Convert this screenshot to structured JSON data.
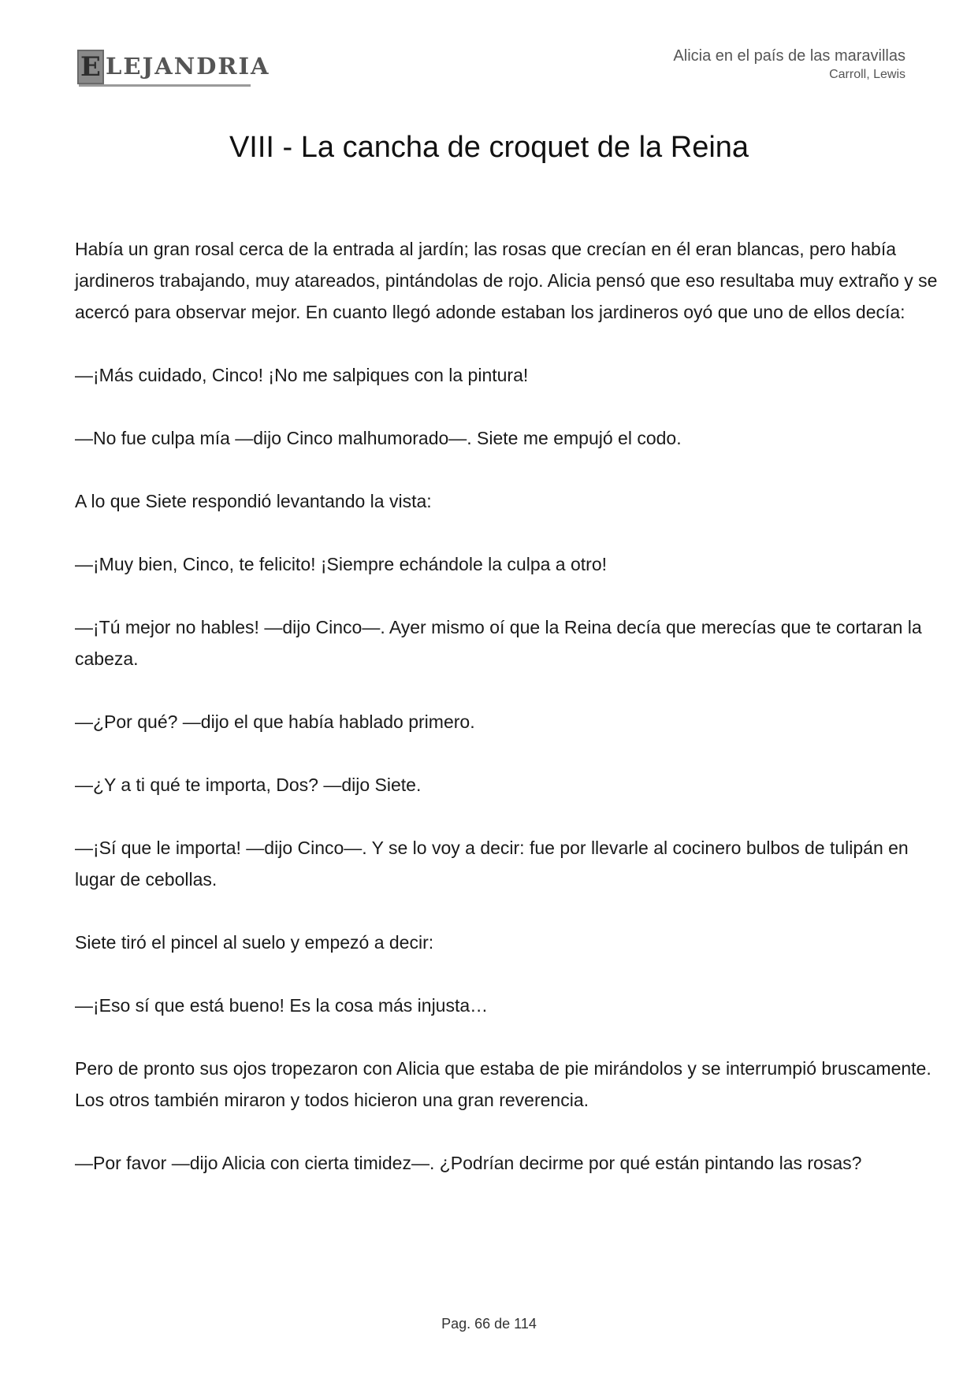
{
  "header": {
    "logo_letter": "E",
    "logo_text": "LEJANDRIA",
    "book_title": "Alicia en el país de las maravillas",
    "author": "Carroll, Lewis"
  },
  "chapter_title": "VIII - La cancha de croquet de la Reina",
  "paragraphs": [
    "Había un gran rosal cerca de la entrada al jardín; las rosas que crecían en él eran blancas, pero había jardineros trabajando, muy atareados, pintándolas de rojo. Alicia pensó que eso resultaba muy extraño y se acercó para observar mejor. En cuanto llegó adonde estaban los jardineros oyó que uno de ellos decía:",
    "—¡Más cuidado, Cinco! ¡No me salpiques con la pintura!",
    "—No fue culpa mía —dijo Cinco malhumorado—. Siete me empujó el codo.",
    "A lo que Siete respondió levantando la vista:",
    "—¡Muy bien, Cinco, te felicito! ¡Siempre echándole la culpa a otro!",
    "—¡Tú mejor no hables! —dijo Cinco—. Ayer mismo oí que la Reina decía que merecías que te cortaran la cabeza.",
    "—¿Por qué? —dijo el que había hablado primero.",
    "—¿Y a ti qué te importa, Dos? —dijo Siete.",
    "—¡Sí que le importa! —dijo Cinco—. Y se lo voy a decir: fue por llevarle al cocinero bulbos de tulipán en lugar de cebollas.",
    "Siete tiró el pincel al suelo y empezó a decir:",
    "—¡Eso sí que está bueno! Es la cosa más injusta…",
    "Pero de pronto sus ojos tropezaron con Alicia que estaba de pie mirándolos y se interrumpió bruscamente. Los otros también miraron y todos hicieron una gran reverencia.",
    "—Por favor —dijo Alicia con cierta timidez—. ¿Podrían decirme por qué están pintando las rosas?"
  ],
  "footer": {
    "page_label": "Pag. 66 de 114"
  }
}
